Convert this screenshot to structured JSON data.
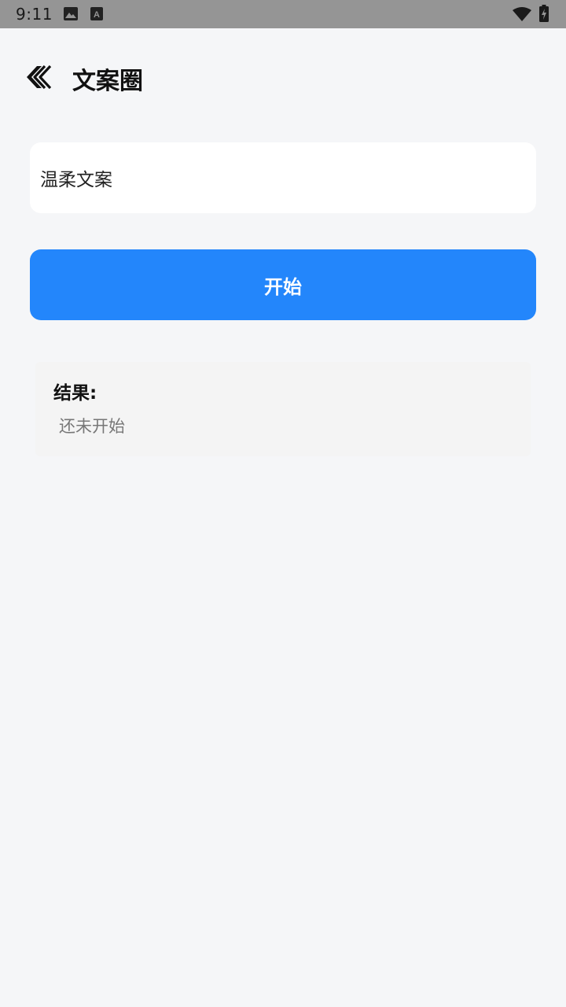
{
  "status_bar": {
    "time": "9:11",
    "icons": [
      "image-icon",
      "a-icon",
      "wifi-icon",
      "battery-charging-icon"
    ]
  },
  "header": {
    "back_icon": "double-chevron-left-icon",
    "title": "文案圈"
  },
  "input": {
    "value": "温柔文案"
  },
  "start_button": {
    "label": "开始",
    "color": "#2386fb"
  },
  "result": {
    "heading": "结果:",
    "text": "还未开始"
  }
}
